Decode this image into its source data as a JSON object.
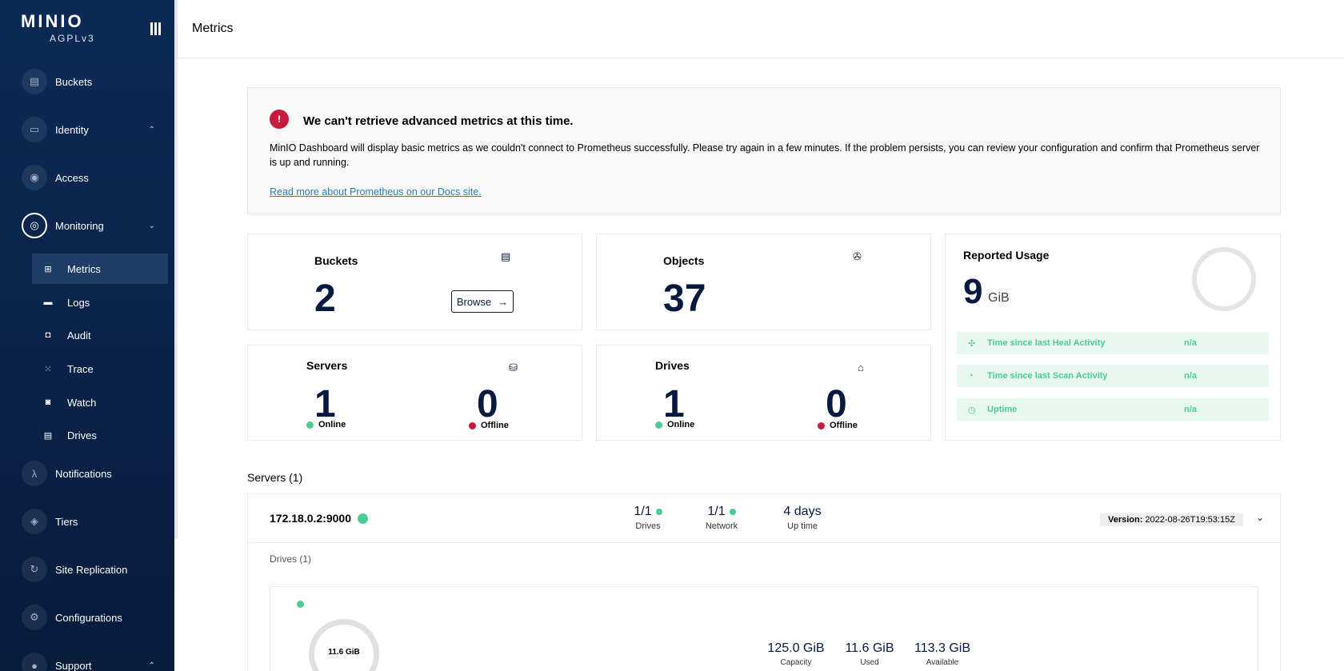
{
  "brand": {
    "logo": "MINIO",
    "edition": "AGPLv3"
  },
  "sidebar": {
    "items": [
      {
        "label": "Buckets",
        "icon": "bucket-icon",
        "glyph": "▤"
      },
      {
        "label": "Identity",
        "icon": "identity-icon",
        "glyph": "▭",
        "chevron": "⌃"
      },
      {
        "label": "Access",
        "icon": "lock-icon",
        "glyph": "◉"
      },
      {
        "label": "Monitoring",
        "icon": "monitoring-icon",
        "glyph": "◎",
        "chevron": "⌄"
      },
      {
        "label": "Notifications",
        "icon": "lambda-icon",
        "glyph": "λ"
      },
      {
        "label": "Tiers",
        "icon": "tiers-icon",
        "glyph": "◈"
      },
      {
        "label": "Site Replication",
        "icon": "replication-icon",
        "glyph": "↻"
      },
      {
        "label": "Configurations",
        "icon": "gear-icon",
        "glyph": "⚙"
      },
      {
        "label": "Support",
        "icon": "support-icon",
        "glyph": "●",
        "chevron": "⌃"
      }
    ],
    "monitoring_sub": [
      {
        "label": "Metrics",
        "glyph": "⊞",
        "selected": true
      },
      {
        "label": "Logs",
        "glyph": "▬"
      },
      {
        "label": "Audit",
        "glyph": "◘"
      },
      {
        "label": "Trace",
        "glyph": "⁙"
      },
      {
        "label": "Watch",
        "glyph": "◙"
      },
      {
        "label": "Drives",
        "glyph": "▤"
      }
    ]
  },
  "header": {
    "title": "Metrics"
  },
  "alert": {
    "title": "We can't retrieve advanced metrics at this time.",
    "body": "MinIO Dashboard will display basic metrics as we couldn't connect to Prometheus successfully. Please try again in a few minutes. If the problem persists, you can review your configuration and confirm that Prometheus server is up and running.",
    "link": "Read more about Prometheus on our Docs site."
  },
  "cards": {
    "buckets": {
      "title": "Buckets",
      "value": "2",
      "browse": "Browse",
      "arrow": "→"
    },
    "objects": {
      "title": "Objects",
      "value": "37"
    },
    "servers": {
      "title": "Servers",
      "online": "1",
      "offline": "0",
      "online_label": "Online",
      "offline_label": "Offline"
    },
    "drives": {
      "title": "Drives",
      "online": "1",
      "offline": "0",
      "online_label": "Online",
      "offline_label": "Offline"
    },
    "usage": {
      "title": "Reported Usage",
      "value": "9",
      "unit": "GiB",
      "rows": [
        {
          "label": "Time since last Heal Activity",
          "value": "n/a",
          "glyph": "✣"
        },
        {
          "label": "Time since last Scan Activity",
          "value": "n/a",
          "glyph": "◔"
        },
        {
          "label": "Uptime",
          "value": "n/a",
          "glyph": "◷"
        }
      ]
    }
  },
  "servers_section": {
    "title": "Servers (1)",
    "server": {
      "endpoint": "172.18.0.2:9000",
      "drives_value": "1/1",
      "drives_label": "Drives",
      "network_value": "1/1",
      "network_label": "Network",
      "uptime_value": "4 days",
      "uptime_label": "Up time",
      "version_label": "Version:",
      "version_value": "2022-08-26T19:53:15Z"
    },
    "drives_title": "Drives (1)",
    "drive": {
      "ring_label": "11.6 GiB",
      "capacity_value": "125.0 GiB",
      "capacity_label": "Capacity",
      "used_value": "11.6 GiB",
      "used_label": "Used",
      "available_value": "113.3 GiB",
      "available_label": "Available"
    }
  },
  "colors": {
    "sidebar": "#0c2a56",
    "accent_green": "#4ccb92",
    "accent_red": "#c51b3f",
    "text_dark": "#07193e"
  }
}
